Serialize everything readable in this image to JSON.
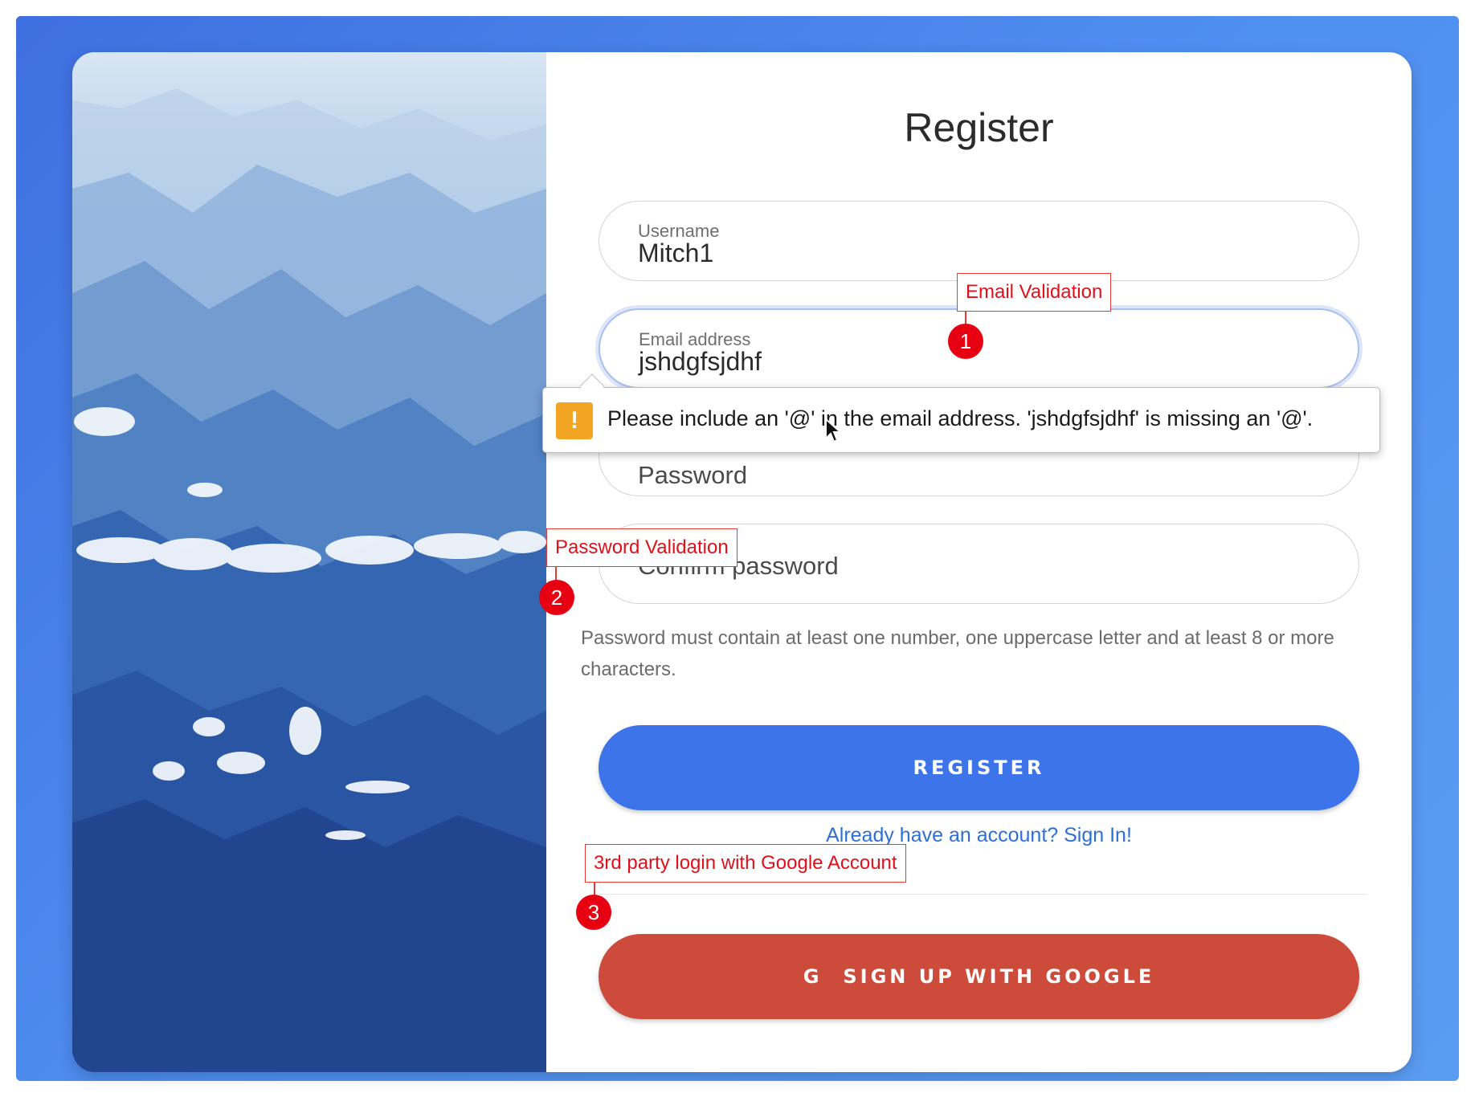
{
  "form": {
    "title": "Register",
    "username": {
      "label": "Username",
      "value": "Mitch1"
    },
    "email": {
      "label": "Email address",
      "value": "jshdgfsjdhf"
    },
    "password": {
      "placeholder": "Password"
    },
    "confirm_password": {
      "placeholder": "Confirm password"
    },
    "password_hint": "Password must contain at least one number, one uppercase letter and at least 8 or more characters.",
    "register_button": "REGISTER",
    "signin_link": "Already have an account? Sign In!",
    "google_button": "SIGN UP WITH GOOGLE",
    "google_glyph": "G"
  },
  "validation_tooltip": {
    "icon": "warning-icon",
    "icon_glyph": "!",
    "message": "Please include an '@' in the email address. 'jshdgfsjdhf' is missing an '@'."
  },
  "annotations": [
    {
      "number": "1",
      "label": "Email Validation"
    },
    {
      "number": "2",
      "label": "Password Validation"
    },
    {
      "number": "3",
      "label": "3rd party login with Google Account"
    }
  ],
  "colors": {
    "background_gradient": "#4f8ff0",
    "register_button": "#3d74ea",
    "google_button": "#cd4b3a",
    "link": "#2d6fd6",
    "annotation_red": "#e60012",
    "warning": "#f2a523"
  }
}
